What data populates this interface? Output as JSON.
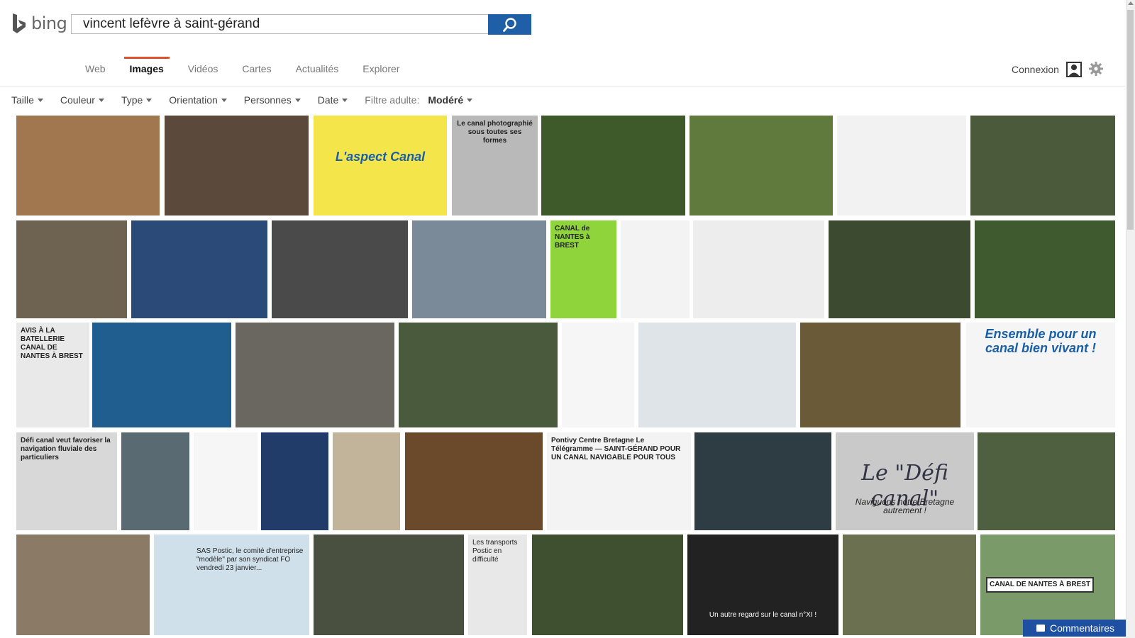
{
  "header": {
    "logo_text": "bing",
    "search_query": "vincent lefèvre à saint-gérand",
    "search_icon": "magnifier-icon",
    "signin_label": "Connexion"
  },
  "nav": {
    "tabs": [
      {
        "label": "Web",
        "active": false
      },
      {
        "label": "Images",
        "active": true
      },
      {
        "label": "Vidéos",
        "active": false
      },
      {
        "label": "Cartes",
        "active": false
      },
      {
        "label": "Actualités",
        "active": false
      },
      {
        "label": "Explorer",
        "active": false
      }
    ]
  },
  "filters": {
    "items": [
      "Taille",
      "Couleur",
      "Type",
      "Orientation",
      "Personnes",
      "Date"
    ],
    "adult_label": "Filtre adulte:",
    "adult_value": "Modéré"
  },
  "results": {
    "rows": [
      [
        "#a1774f",
        "#5b4a3c",
        "#f4e64a",
        "#b9b9b9",
        "#3f5a2a",
        "#5f7a3c",
        "#f2f2f2",
        "#4a5a3a"
      ],
      [
        "#6e6350",
        "#2b4a78",
        "#4a4a4a",
        "#7a8a98",
        "#8fd43a",
        "#f3f3f3",
        "#ededed",
        "#3c4a30",
        "#3e5a2e"
      ],
      [
        "#e9e9e9",
        "#1f5e8e",
        "#6a6660",
        "#4a5a3c",
        "#f6f6f6",
        "#dfe4e8",
        "#6a5a38",
        "#f5f5f5"
      ],
      [
        "#d8d8d8",
        "#5a6a72",
        "#f6f6f6",
        "#223c6a",
        "#c2b49a",
        "#6a4a2a",
        "#f3f3f3",
        "#2e3c44",
        "#c9c9c9",
        "#4e6040"
      ],
      [
        "#8a7a66",
        "#cfe0ea",
        "#4a5040",
        "#e8e8e8",
        "#3e5030",
        "#222222",
        "#6a7050",
        "#7a9a6a"
      ]
    ],
    "captions": {
      "r0c3": "Le canal photographié sous toutes ses formes",
      "r1c4": "CANAL de NANTES à BREST",
      "r2c0": "AVIS À LA BATELLERIE CANAL DE NANTES À BREST",
      "r2c7": "Ensemble pour un canal bien vivant !",
      "r3c0": "Défi canal veut favoriser la navigation fluviale des particuliers",
      "r3c6": "Pontivy Centre Bretagne Le Télégramme — SAINT-GÉRAND POUR UN CANAL NAVIGABLE POUR TOUS",
      "r3c8": "Le \"Défi canal\"",
      "r3c8b": "Naviguons notre Bretagne autrement !",
      "r4c1": "SAS Postic, le comité d'entreprise \"modèle\" par son syndicat FO vendredi 23 janvier...",
      "r4c3": "Les transports Postic en difficulté",
      "r4c5": "Un autre regard sur le canal n°XI !",
      "r4c7": "CANAL DE NANTES À BREST"
    }
  },
  "feedback_label": "Commentaires"
}
